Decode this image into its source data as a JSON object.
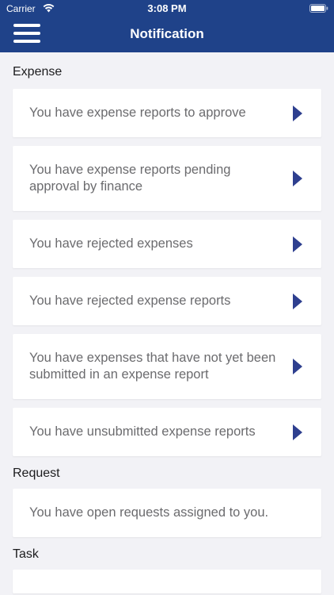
{
  "status_bar": {
    "carrier": "Carrier",
    "time": "3:08 PM"
  },
  "nav": {
    "title": "Notification"
  },
  "colors": {
    "header_bg": "#1f4289",
    "chevron": "#2e3f8f",
    "page_bg": "#f2f2f6"
  },
  "sections": {
    "expense": {
      "title": "Expense",
      "items": [
        "You have expense reports to approve",
        "You have expense reports pending approval by finance",
        "You have rejected expenses",
        "You have rejected expense reports",
        "You have expenses that have not yet been submitted in an expense report",
        "You have unsubmitted expense reports"
      ]
    },
    "request": {
      "title": "Request",
      "items": [
        "You have open requests assigned to you."
      ]
    },
    "task": {
      "title": "Task"
    }
  }
}
